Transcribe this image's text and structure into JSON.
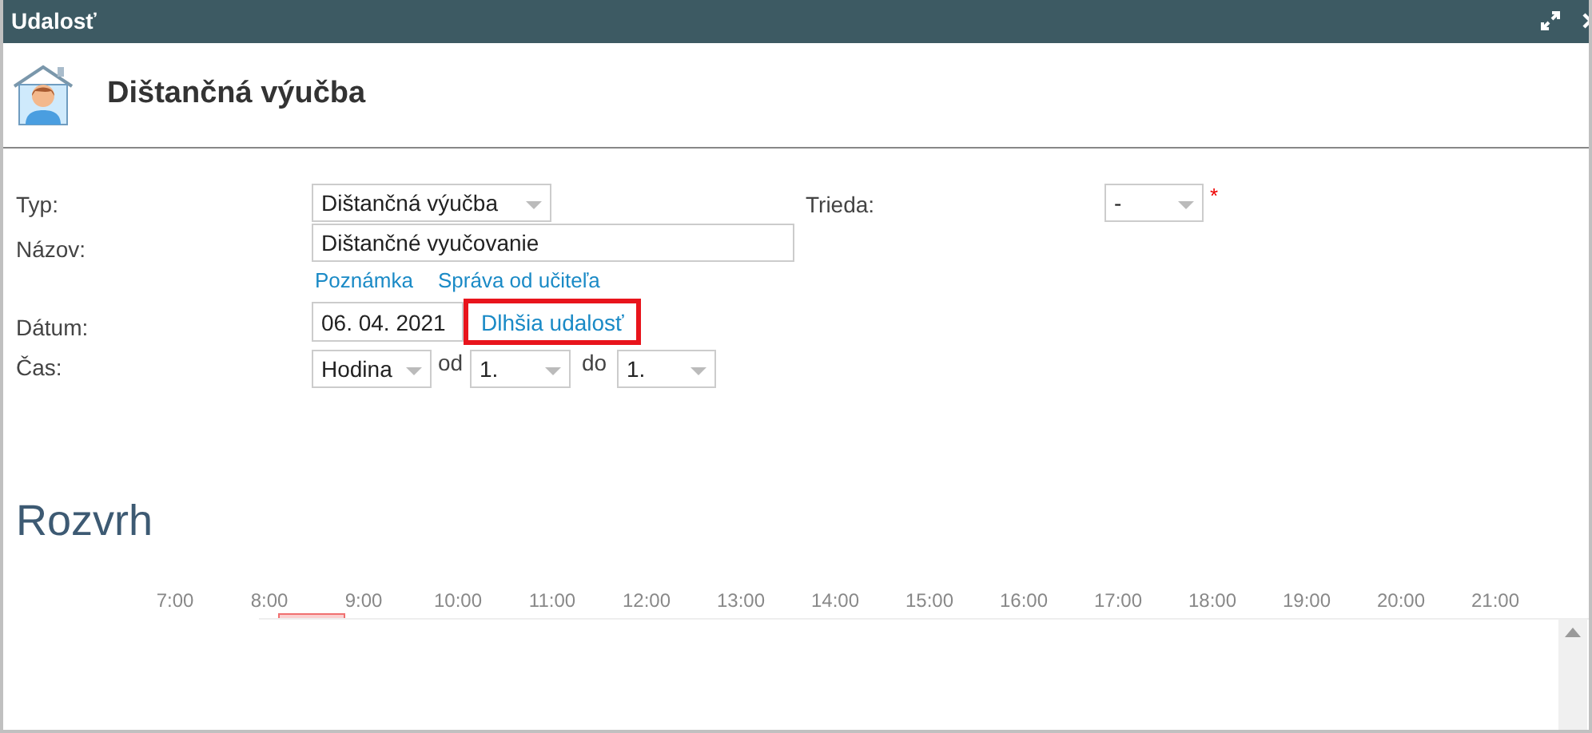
{
  "window": {
    "title": "Udalosť"
  },
  "header": {
    "title": "Dištančná výučba"
  },
  "form": {
    "type": {
      "label": "Typ:",
      "value": "Dištančná výučba"
    },
    "name": {
      "label": "Názov:",
      "value": "Dištančné vyučovanie"
    },
    "links": [
      "Poznámka",
      "Správa od učiteľa"
    ],
    "date": {
      "label": "Dátum:",
      "value": "06. 04. 2021",
      "link": "Dlhšia udalosť",
      "highlighted": true
    },
    "time": {
      "label": "Čas:",
      "unit": "Hodina",
      "from_label": "od",
      "from": "1.",
      "to_label": "do",
      "to": "1."
    },
    "class": {
      "label": "Trieda:",
      "value": "-",
      "required_mark": "*"
    }
  },
  "schedule": {
    "title": "Rozvrh",
    "hours": [
      {
        "label": "7:00",
        "selected": false
      },
      {
        "label": "8:00",
        "selected": true
      },
      {
        "label": "9:00",
        "selected": false
      },
      {
        "label": "10:00",
        "selected": false
      },
      {
        "label": "11:00",
        "selected": false
      },
      {
        "label": "12:00",
        "selected": false
      },
      {
        "label": "13:00",
        "selected": false
      },
      {
        "label": "14:00",
        "selected": false
      },
      {
        "label": "15:00",
        "selected": false
      },
      {
        "label": "16:00",
        "selected": false
      },
      {
        "label": "17:00",
        "selected": false
      },
      {
        "label": "18:00",
        "selected": false
      },
      {
        "label": "19:00",
        "selected": false
      },
      {
        "label": "20:00",
        "selected": false
      },
      {
        "label": "21:00",
        "selected": false
      }
    ]
  }
}
